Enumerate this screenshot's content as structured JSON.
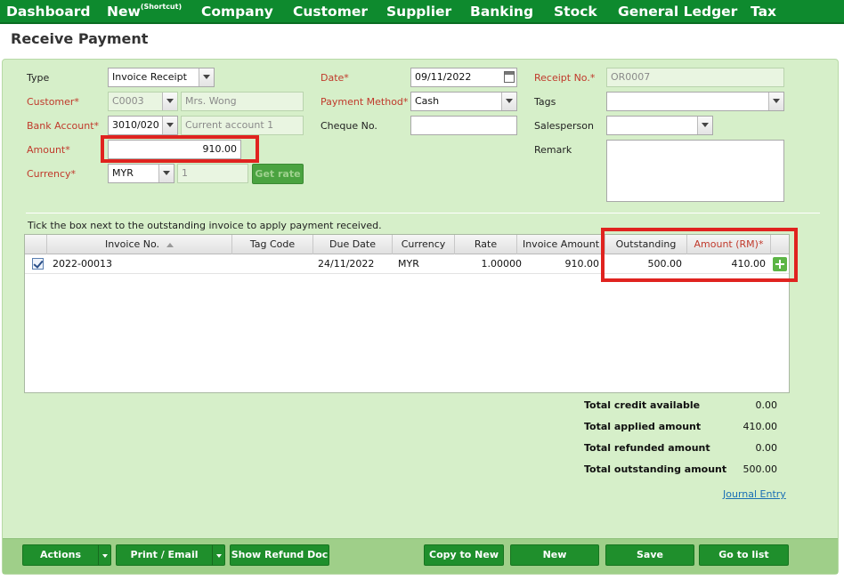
{
  "nav": {
    "dashboard": "Dashboard",
    "new": "New",
    "new_sup": "(Shortcut)",
    "company": "Company",
    "customer": "Customer",
    "supplier": "Supplier",
    "banking": "Banking",
    "stock": "Stock",
    "general_ledger": "General Ledger",
    "tax": "Tax"
  },
  "page_title": "Receive Payment",
  "form": {
    "type_label": "Type",
    "type_value": "Invoice Receipt",
    "customer_label": "Customer*",
    "customer_code": "C0003",
    "customer_name": "Mrs. Wong",
    "bank_label": "Bank Account*",
    "bank_code": "3010/020",
    "bank_name": "Current account 1",
    "amount_label": "Amount*",
    "amount_value": "910.00",
    "currency_label": "Currency*",
    "currency_value": "MYR",
    "rate_value": "1",
    "get_rate": "Get rate",
    "date_label": "Date*",
    "date_value": "09/11/2022",
    "method_label": "Payment Method*",
    "method_value": "Cash",
    "cheque_label": "Cheque No.",
    "cheque_value": "",
    "receipt_label": "Receipt No.*",
    "receipt_value": "OR0007",
    "tags_label": "Tags",
    "tags_value": "",
    "salesperson_label": "Salesperson",
    "salesperson_value": "",
    "remark_label": "Remark",
    "remark_value": ""
  },
  "tick_note": "Tick the box next to the outstanding invoice to apply payment received.",
  "grid": {
    "headers": {
      "invoice_no": "Invoice No.",
      "tag_code": "Tag Code",
      "due_date": "Due Date",
      "currency": "Currency",
      "rate": "Rate",
      "invoice_amount": "Invoice Amount",
      "outstanding": "Outstanding",
      "amount_rm": "Amount (RM)*"
    },
    "rows": [
      {
        "invoice_no": "2022-00013",
        "tag_code": "",
        "due_date": "24/11/2022",
        "currency": "MYR",
        "rate": "1.00000",
        "invoice_amount": "910.00",
        "outstanding": "500.00",
        "amount_rm": "410.00"
      }
    ]
  },
  "totals": {
    "credit_label": "Total credit available",
    "credit_value": "0.00",
    "applied_label": "Total applied amount",
    "applied_value": "410.00",
    "refunded_label": "Total refunded amount",
    "refunded_value": "0.00",
    "outstanding_label": "Total outstanding amount",
    "outstanding_value": "500.00"
  },
  "journal_entry": "Journal Entry",
  "footer": {
    "actions": "Actions",
    "print_email": "Print / Email",
    "show_refund": "Show Refund Doc",
    "copy_to_new": "Copy to New",
    "new": "New",
    "save": "Save",
    "go_to_list": "Go to list"
  },
  "colors": {
    "nav_bg": "#0e8a2e",
    "panel_bg": "#d6efc9",
    "required_label": "#c0392b",
    "highlight_box": "#e0231f",
    "button_bg": "#1f8f2c"
  }
}
